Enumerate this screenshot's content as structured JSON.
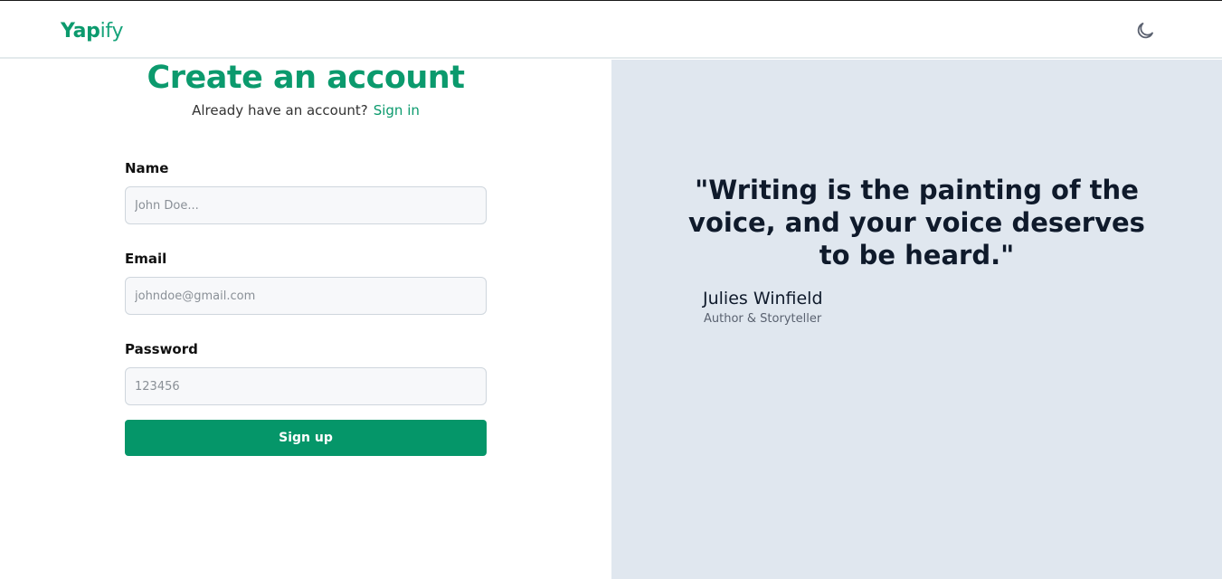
{
  "header": {
    "logo_strong": "Yap",
    "logo_light": "ify",
    "theme_toggle_icon": "moon-icon"
  },
  "signup": {
    "title": "Create an account",
    "prompt": "Already have an account?",
    "signin_link": "Sign in",
    "fields": {
      "name": {
        "label": "Name",
        "placeholder": "John Doe..."
      },
      "email": {
        "label": "Email",
        "placeholder": "johndoe@gmail.com"
      },
      "password": {
        "label": "Password",
        "placeholder": "123456"
      }
    },
    "submit_label": "Sign up"
  },
  "testimonial": {
    "quote": "\"Writing is the painting of the voice, and your voice deserves to be heard.\"",
    "author": "Julies Winfield",
    "role": "Author & Storyteller"
  },
  "colors": {
    "brand": "#0b9a6d",
    "button": "#059669",
    "panel": "#e0e7ef"
  }
}
